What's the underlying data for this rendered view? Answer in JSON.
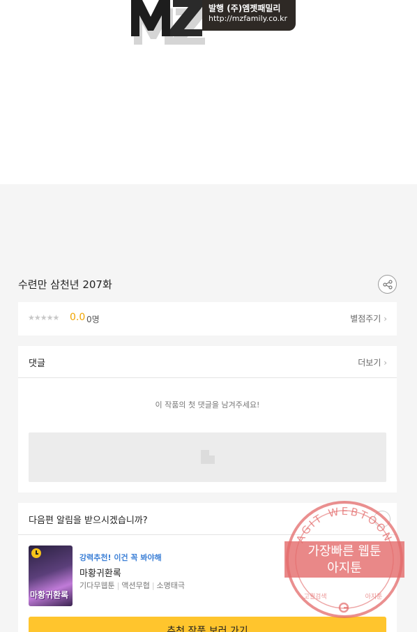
{
  "publisher": {
    "logo_letters": "MZ",
    "line1": "발행 (주)엠젯패밀리",
    "line2": "http://mzfamily.co.kr"
  },
  "episode": {
    "title": "수련만 삼천년 207화",
    "share_icon": "share-icon"
  },
  "rating": {
    "stars": "★★★★★",
    "score": "0.0",
    "count": "0명",
    "rate_link": "별점주기"
  },
  "comments": {
    "title": "댓글",
    "more_link": "더보기",
    "empty_message": "이 작품의 첫 댓글을 남겨주세요!"
  },
  "next_alert": {
    "title": "다음편 알림을 받으시겠습니까?"
  },
  "recommendation": {
    "tag": "강력추천! 이건 꼭 봐야해",
    "title": "마황귀환록",
    "thumb_label": "마황귀환록",
    "genres": [
      "기다무웹툰",
      "액션무협",
      "소명태극"
    ],
    "cta": "추천 작품 보러 가기"
  },
  "watermark": {
    "arc_text": "AGIT WEBTOON",
    "line1": "가장빠른 웹툰",
    "line2": "아지툰",
    "bottom_left": "고퀄검색",
    "bottom_right": "아지툰"
  },
  "colors": {
    "score": "#f0a400",
    "recommend_tag": "#3b7fd6",
    "cta": "#ffc52d",
    "stamp": "#e36a6a"
  }
}
